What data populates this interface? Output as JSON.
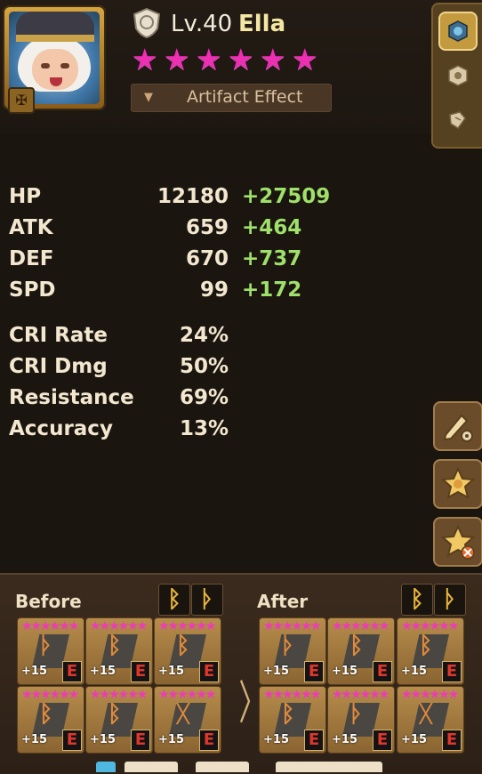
{
  "hero": {
    "level": "Lv.40",
    "name": "Ella",
    "stars": [
      "★",
      "★",
      "★",
      "★",
      "★",
      "★"
    ],
    "artifact_label": "Artifact Effect",
    "badge_icon": "cross-emblem-icon"
  },
  "stats": [
    {
      "label": "HP",
      "base": "12180",
      "bonus": "+27509"
    },
    {
      "label": "ATK",
      "base": "659",
      "bonus": "+464"
    },
    {
      "label": "DEF",
      "base": "670",
      "bonus": "+737"
    },
    {
      "label": "SPD",
      "base": "99",
      "bonus": "+172"
    }
  ],
  "secondary_stats": [
    {
      "label": "CRI Rate",
      "value": "24%"
    },
    {
      "label": "CRI Dmg",
      "value": "50%"
    },
    {
      "label": "Resistance",
      "value": "69%"
    },
    {
      "label": "Accuracy",
      "value": "13%"
    }
  ],
  "runes": {
    "before_label": "Before",
    "after_label": "After",
    "before": [
      {
        "stars": "★★★★★★",
        "glyph": "ᚦ",
        "level": "+15",
        "grade": "E"
      },
      {
        "stars": "★★★★★★",
        "glyph": "ᛒ",
        "level": "+15",
        "grade": "E"
      },
      {
        "stars": "★★★★★★",
        "glyph": "ᛒ",
        "level": "+15",
        "grade": "E"
      },
      {
        "stars": "★★★★★★",
        "glyph": "ᛒ",
        "level": "+15",
        "grade": "E"
      },
      {
        "stars": "★★★★★★",
        "glyph": "ᛒ",
        "level": "+15",
        "grade": "E"
      },
      {
        "stars": "★★★★★★",
        "glyph": "ᚷ",
        "level": "+15",
        "grade": "E"
      }
    ],
    "after": [
      {
        "stars": "★★★★★★",
        "glyph": "ᚦ",
        "level": "+15",
        "grade": "E"
      },
      {
        "stars": "★★★★★★",
        "glyph": "ᛒ",
        "level": "+15",
        "grade": "E"
      },
      {
        "stars": "★★★★★★",
        "glyph": "ᛒ",
        "level": "+15",
        "grade": "E"
      },
      {
        "stars": "★★★★★★",
        "glyph": "ᛒ",
        "level": "+15",
        "grade": "E"
      },
      {
        "stars": "★★★★★★",
        "glyph": "ᚦ",
        "level": "+15",
        "grade": "E"
      },
      {
        "stars": "★★★★★★",
        "glyph": "ᚷ",
        "level": "+15",
        "grade": "E"
      }
    ],
    "set_icons": [
      "ᛒ",
      "ᚦ"
    ]
  },
  "colors": {
    "bonus_green": "#9fe06a",
    "star_pink": "#ec2fb3",
    "grade_red": "#e0372d",
    "panel_gold": "#c39a3d"
  }
}
